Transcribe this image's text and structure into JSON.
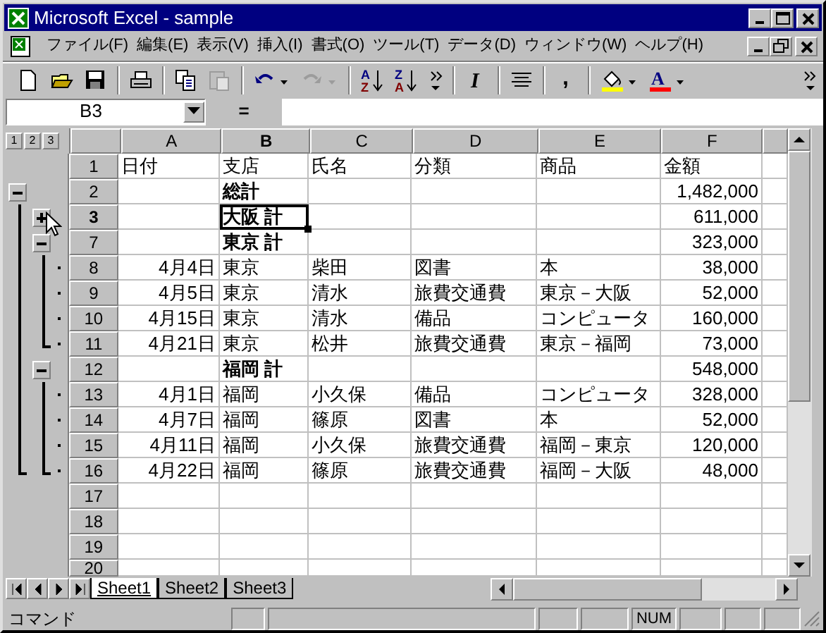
{
  "window": {
    "title": "Microsoft Excel - sample"
  },
  "menu": [
    "ファイル(F)",
    "編集(E)",
    "表示(V)",
    "挿入(I)",
    "書式(O)",
    "ツール(T)",
    "データ(D)",
    "ウィンドウ(W)",
    "ヘルプ(H)"
  ],
  "toolbar": [
    {
      "kind": "new",
      "disabled": false
    },
    {
      "kind": "open",
      "disabled": false
    },
    {
      "kind": "save",
      "disabled": false
    },
    {
      "kind": "sep"
    },
    {
      "kind": "print",
      "disabled": false
    },
    {
      "kind": "sep"
    },
    {
      "kind": "copy",
      "disabled": false
    },
    {
      "kind": "paste",
      "disabled": true
    },
    {
      "kind": "sep"
    },
    {
      "kind": "undo",
      "disabled": false
    },
    {
      "kind": "redo",
      "disabled": true
    },
    {
      "kind": "sep"
    },
    {
      "kind": "sort_asc",
      "text": [
        "A",
        "Z"
      ]
    },
    {
      "kind": "sort_desc",
      "text": [
        "Z",
        "A"
      ]
    },
    {
      "kind": "more"
    },
    {
      "kind": "sep"
    },
    {
      "kind": "italic",
      "text": "I"
    },
    {
      "kind": "sep"
    },
    {
      "kind": "center"
    },
    {
      "kind": "sep"
    },
    {
      "kind": "comma",
      "text": ","
    },
    {
      "kind": "sep"
    },
    {
      "kind": "fill",
      "color": "#ffff00"
    },
    {
      "kind": "fontcolor",
      "text": "A",
      "color": "#ff0000"
    }
  ],
  "formula_bar": {
    "name_box": "B3",
    "sign": "="
  },
  "outline_levels": [
    "1",
    "2",
    "3"
  ],
  "columns": [
    {
      "label": "A",
      "selected": false
    },
    {
      "label": "B",
      "selected": true
    },
    {
      "label": "C",
      "selected": false
    },
    {
      "label": "D",
      "selected": false
    },
    {
      "label": "E",
      "selected": false
    },
    {
      "label": "F",
      "selected": false
    }
  ],
  "rows": [
    {
      "number": "1",
      "kind": "header",
      "selected": false,
      "cells": {
        "A": "日付",
        "B": "支店",
        "C": "氏名",
        "D": "分類",
        "E": "商品",
        "F": "金額"
      }
    },
    {
      "number": "2",
      "kind": "grand_total",
      "selected": false,
      "outline": {
        "expanded": true
      },
      "cells": {
        "B": "総計",
        "F": "1,482,000"
      }
    },
    {
      "number": "3",
      "kind": "subtotal",
      "selected": true,
      "outline": {
        "expanded": false
      },
      "cells": {
        "B": "大阪 計",
        "F": "611,000"
      }
    },
    {
      "number": "7",
      "kind": "subtotal",
      "selected": false,
      "outline": {
        "expanded": true
      },
      "cells": {
        "B": "東京 計",
        "F": "323,000"
      }
    },
    {
      "number": "8",
      "kind": "detail",
      "selected": false,
      "cells": {
        "A": "4月4日",
        "B": "東京",
        "C": "柴田",
        "D": "図書",
        "E": "本",
        "F": "38,000"
      }
    },
    {
      "number": "9",
      "kind": "detail",
      "selected": false,
      "cells": {
        "A": "4月5日",
        "B": "東京",
        "C": "清水",
        "D": "旅費交通費",
        "E": "東京－大阪",
        "F": "52,000"
      }
    },
    {
      "number": "10",
      "kind": "detail",
      "selected": false,
      "cells": {
        "A": "4月15日",
        "B": "東京",
        "C": "清水",
        "D": "備品",
        "E": "コンピュータ",
        "F": "160,000"
      }
    },
    {
      "number": "11",
      "kind": "detail",
      "selected": false,
      "cells": {
        "A": "4月21日",
        "B": "東京",
        "C": "松井",
        "D": "旅費交通費",
        "E": "東京－福岡",
        "F": "73,000"
      }
    },
    {
      "number": "12",
      "kind": "subtotal",
      "selected": false,
      "outline": {
        "expanded": true
      },
      "cells": {
        "B": "福岡 計",
        "F": "548,000"
      }
    },
    {
      "number": "13",
      "kind": "detail",
      "selected": false,
      "cells": {
        "A": "4月1日",
        "B": "福岡",
        "C": "小久保",
        "D": "備品",
        "E": "コンピュータ",
        "F": "328,000"
      }
    },
    {
      "number": "14",
      "kind": "detail",
      "selected": false,
      "cells": {
        "A": "4月7日",
        "B": "福岡",
        "C": "篠原",
        "D": "図書",
        "E": "本",
        "F": "52,000"
      }
    },
    {
      "number": "15",
      "kind": "detail",
      "selected": false,
      "cells": {
        "A": "4月11日",
        "B": "福岡",
        "C": "小久保",
        "D": "旅費交通費",
        "E": "福岡－東京",
        "F": "120,000"
      }
    },
    {
      "number": "16",
      "kind": "detail",
      "selected": false,
      "cells": {
        "A": "4月22日",
        "B": "福岡",
        "C": "篠原",
        "D": "旅費交通費",
        "E": "福岡－大阪",
        "F": "48,000"
      }
    },
    {
      "number": "17",
      "kind": "empty",
      "selected": false
    },
    {
      "number": "18",
      "kind": "empty",
      "selected": false
    },
    {
      "number": "19",
      "kind": "empty",
      "selected": false
    },
    {
      "number": "20",
      "kind": "empty",
      "selected": false
    }
  ],
  "sheets": [
    {
      "label": "Sheet1",
      "selected": true
    },
    {
      "label": "Sheet2",
      "selected": false
    },
    {
      "label": "Sheet3",
      "selected": false
    }
  ],
  "status_bar": {
    "text": "コマンド",
    "indicators": [
      "NUM"
    ]
  }
}
